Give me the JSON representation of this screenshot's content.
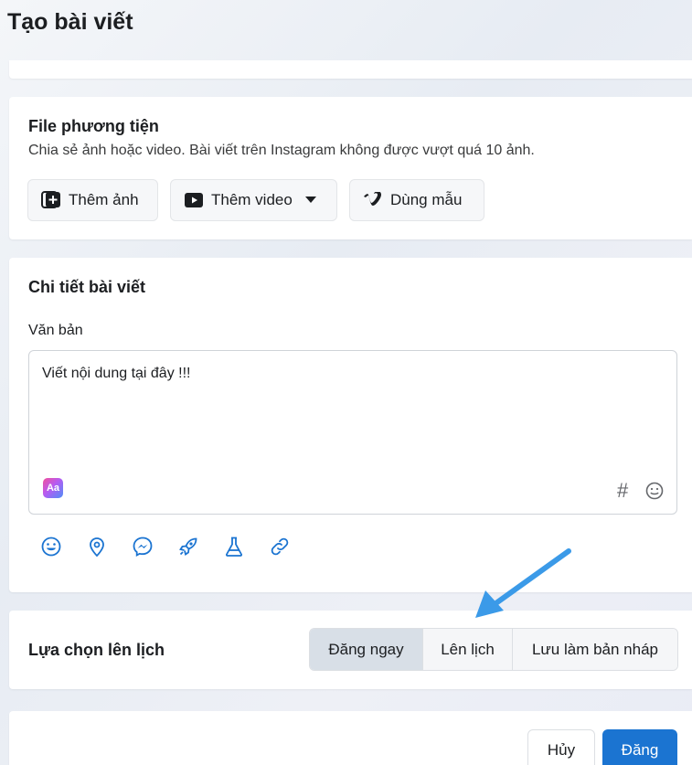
{
  "page": {
    "title": "Tạo bài viết"
  },
  "media": {
    "title": "File phương tiện",
    "description": "Chia sẻ ảnh hoặc video. Bài viết trên Instagram không được vượt quá 10 ảnh.",
    "buttons": {
      "add_photo": "Thêm ảnh",
      "add_video": "Thêm video",
      "use_template": "Dùng mẫu"
    }
  },
  "details": {
    "title": "Chi tiết bài viết",
    "text_label": "Văn bản",
    "text_value": "Viết nội dung tại đây !!!",
    "aa_badge": "Aa",
    "hashtag": "#",
    "tools": [
      "emoji-icon",
      "location-pin-icon",
      "messenger-icon",
      "rocket-icon",
      "flask-icon",
      "link-icon"
    ]
  },
  "schedule": {
    "title": "Lựa chọn lên lịch",
    "options": [
      "Đăng ngay",
      "Lên lịch",
      "Lưu làm bản nháp"
    ],
    "selected": "Đăng ngay"
  },
  "footer": {
    "cancel": "Hủy",
    "post": "Đăng"
  },
  "colors": {
    "primary": "#1b74d1",
    "arrow": "#3b9ae8",
    "tool_icon": "#1b74d1"
  }
}
